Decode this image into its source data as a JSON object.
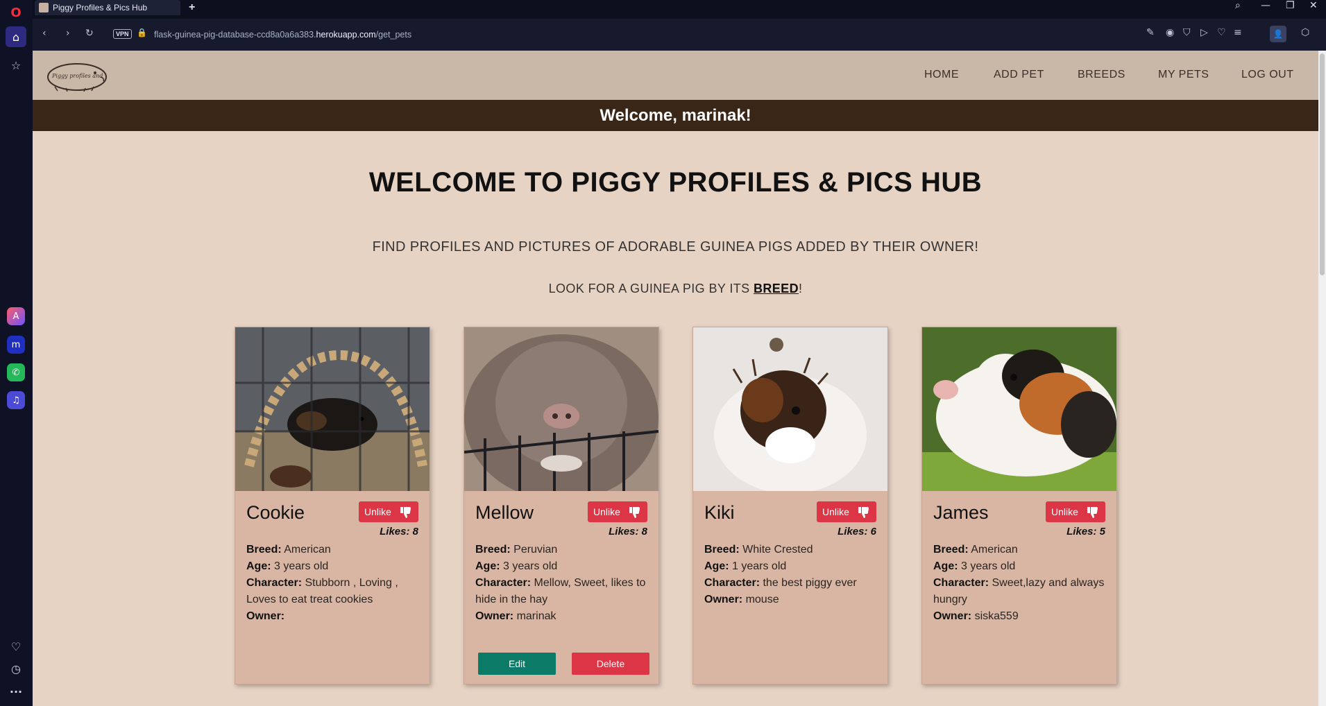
{
  "browser": {
    "tab_title": "Piggy Profiles & Pics Hub",
    "url_prefix": "flask-guinea-pig-database-ccd8a0a6a383.",
    "url_domain": "herokuapp.com",
    "url_path": "/get_pets",
    "vpn_label": "VPN"
  },
  "nav": {
    "logo_text": "Piggy profiles and",
    "links": [
      "HOME",
      "ADD PET",
      "BREEDS",
      "MY PETS",
      "LOG OUT"
    ]
  },
  "welcome_banner": "Welcome, marinak!",
  "hero": {
    "title": "WELCOME TO PIGGY PROFILES & PICS HUB",
    "subtitle": "FIND PROFILES AND PICTURES OF ADORABLE GUINEA PIGS ADDED BY THEIR OWNER!",
    "breed_prefix": "LOOK FOR A GUINEA PIG BY ITS ",
    "breed_link": "BREED",
    "breed_suffix": "!"
  },
  "labels": {
    "breed": "Breed:",
    "age": "Age:",
    "character": "Character:",
    "owner": "Owner:",
    "likes": "Likes:",
    "unlike": "Unlike",
    "edit": "Edit",
    "delete": "Delete"
  },
  "pets": [
    {
      "name": "Cookie",
      "likes": "8",
      "breed": "American",
      "age": "3 years old",
      "character": "Stubborn , Loving , Loves to eat treat cookies",
      "owner": ""
    },
    {
      "name": "Mellow",
      "likes": "8",
      "breed": "Peruvian",
      "age": "3 years old",
      "character": "Mellow, Sweet, likes to hide in the hay",
      "owner": "marinak"
    },
    {
      "name": "Kiki",
      "likes": "6",
      "breed": "White Crested",
      "age": "1 years old",
      "character": "the best piggy ever",
      "owner": "mouse"
    },
    {
      "name": "James",
      "likes": "5",
      "breed": "American",
      "age": "3 years old",
      "character": "Sweet,lazy and always hungry",
      "owner": "siska559"
    }
  ],
  "colors": {
    "nav_bg": "#c9b7a8",
    "banner_bg": "#3a2617",
    "page_bg": "#e7d3c4",
    "card_bg": "#d9b6a3",
    "danger": "#dc3545",
    "edit": "#0b7a66"
  }
}
